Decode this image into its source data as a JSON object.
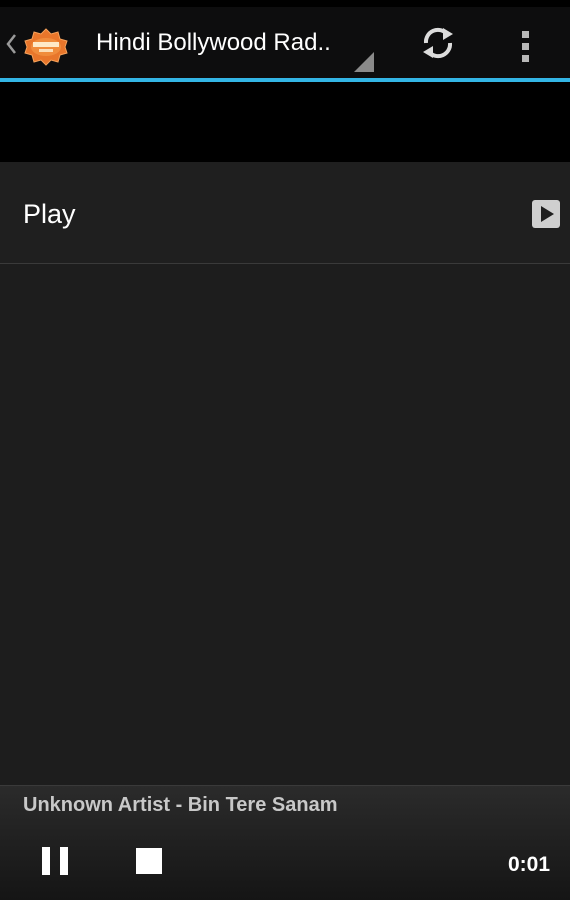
{
  "action_bar": {
    "title": "Hindi Bollywood Rad..",
    "logo_icon": "bollywood-radio-logo-icon",
    "refresh_icon": "refresh-icon",
    "overflow_icon": "overflow-menu-icon",
    "accent_color": "#33b5e5"
  },
  "menu": {
    "play_label": "Play",
    "play_icon": "play-icon"
  },
  "player": {
    "now_playing": "Unknown Artist - Bin Tere Sanam",
    "pause_icon": "pause-icon",
    "stop_icon": "stop-icon",
    "elapsed": "0:01"
  }
}
